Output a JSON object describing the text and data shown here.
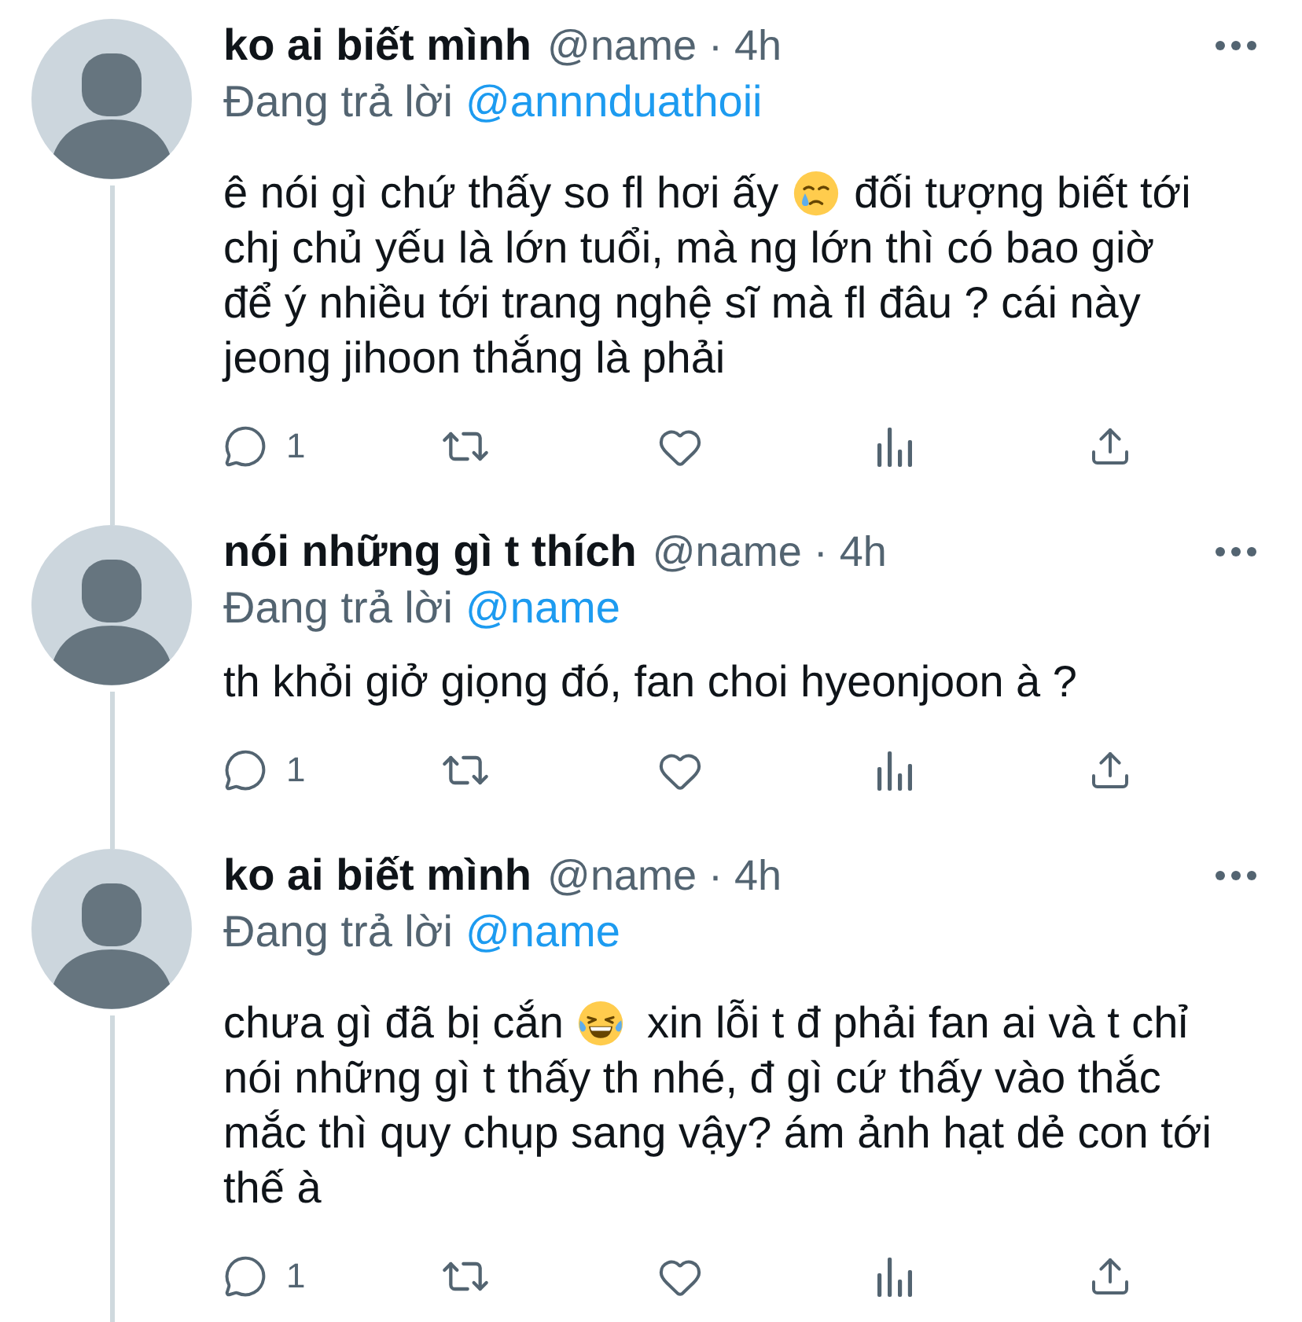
{
  "tweets": [
    {
      "name": "ko ai biết mình",
      "meta": "@name · 4h",
      "reply_label": "Đang trả lời",
      "reply_to": "@annnduathoii",
      "thread_above": false,
      "thread_below": true,
      "lines": [
        [
          {
            "kind": "text",
            "text": "ê nói gì chứ thấy so fl hơi ấy"
          },
          {
            "kind": "teary"
          },
          {
            "kind": "text",
            "text": "đối tượng biết tới"
          }
        ],
        [
          {
            "kind": "text",
            "text": "chj chủ yếu là lớn tuổi, mà ng lớn thì có bao giờ"
          }
        ],
        [
          {
            "kind": "text",
            "text": "để ý nhiều tới trang nghệ sĩ mà fl đâu ? cái này"
          }
        ],
        [
          {
            "kind": "text",
            "text": "jeong jihoon thắng là phải"
          }
        ]
      ],
      "reply_count": "1"
    },
    {
      "name": "nói những gì t thích",
      "meta": "@name · 4h",
      "reply_label": "Đang trả lời",
      "reply_to": "@name",
      "thread_above": true,
      "thread_below": true,
      "lines": [
        [
          {
            "kind": "text",
            "text": "th khỏi giở giọng đó, fan choi hyeonjoon à ?"
          }
        ]
      ],
      "reply_count": "1"
    },
    {
      "name": "ko ai biết mình",
      "meta": "@name · 4h",
      "reply_label": "Đang trả lời",
      "reply_to": "@name",
      "thread_above": true,
      "thread_below": true,
      "lines": [
        [
          {
            "kind": "text",
            "text": "chưa gì đã bị cắn"
          },
          {
            "kind": "laughing"
          },
          {
            "kind": "text",
            "text": "xin lỗi t đ phải fan ai và t chỉ"
          }
        ],
        [
          {
            "kind": "text",
            "text": "nói những gì t thấy th nhé, đ gì cứ thấy vào thắc"
          }
        ],
        [
          {
            "kind": "text",
            "text": "mắc thì quy chụp sang vậy? ám ảnh hạt dẻ con tới"
          }
        ],
        [
          {
            "kind": "text",
            "text": "thế à"
          }
        ]
      ],
      "reply_count": "1"
    }
  ]
}
